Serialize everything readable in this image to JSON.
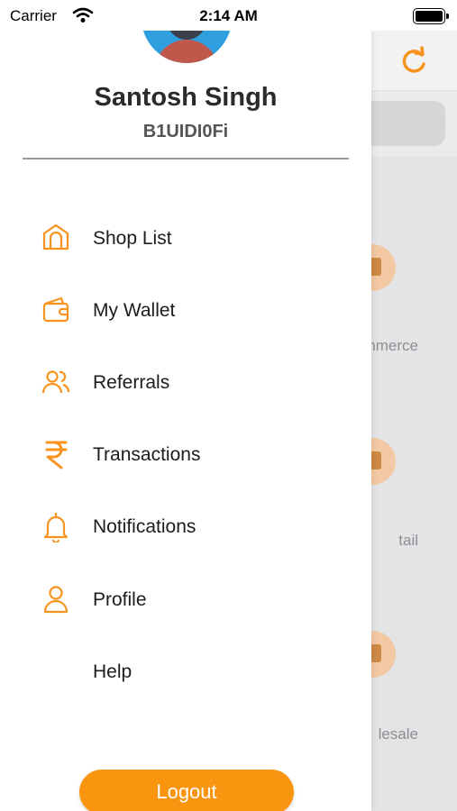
{
  "status_bar": {
    "carrier": "Carrier",
    "time": "2:14 AM"
  },
  "drawer": {
    "user_name": "Santosh Singh",
    "user_code": "B1UIDI0Fi",
    "menu": [
      {
        "label": "Shop List",
        "icon": "shop-icon"
      },
      {
        "label": "My Wallet",
        "icon": "wallet-icon"
      },
      {
        "label": "Referrals",
        "icon": "referrals-icon"
      },
      {
        "label": "Transactions",
        "icon": "rupee-icon"
      },
      {
        "label": "Notifications",
        "icon": "bell-icon"
      },
      {
        "label": "Profile",
        "icon": "user-icon"
      },
      {
        "label": "Help",
        "icon": ""
      }
    ],
    "logout_label": "Logout"
  },
  "background": {
    "categories": [
      "nmerce",
      "tail",
      "lesale"
    ]
  },
  "colors": {
    "accent": "#f7931e",
    "logout_button": "#f9950f"
  }
}
